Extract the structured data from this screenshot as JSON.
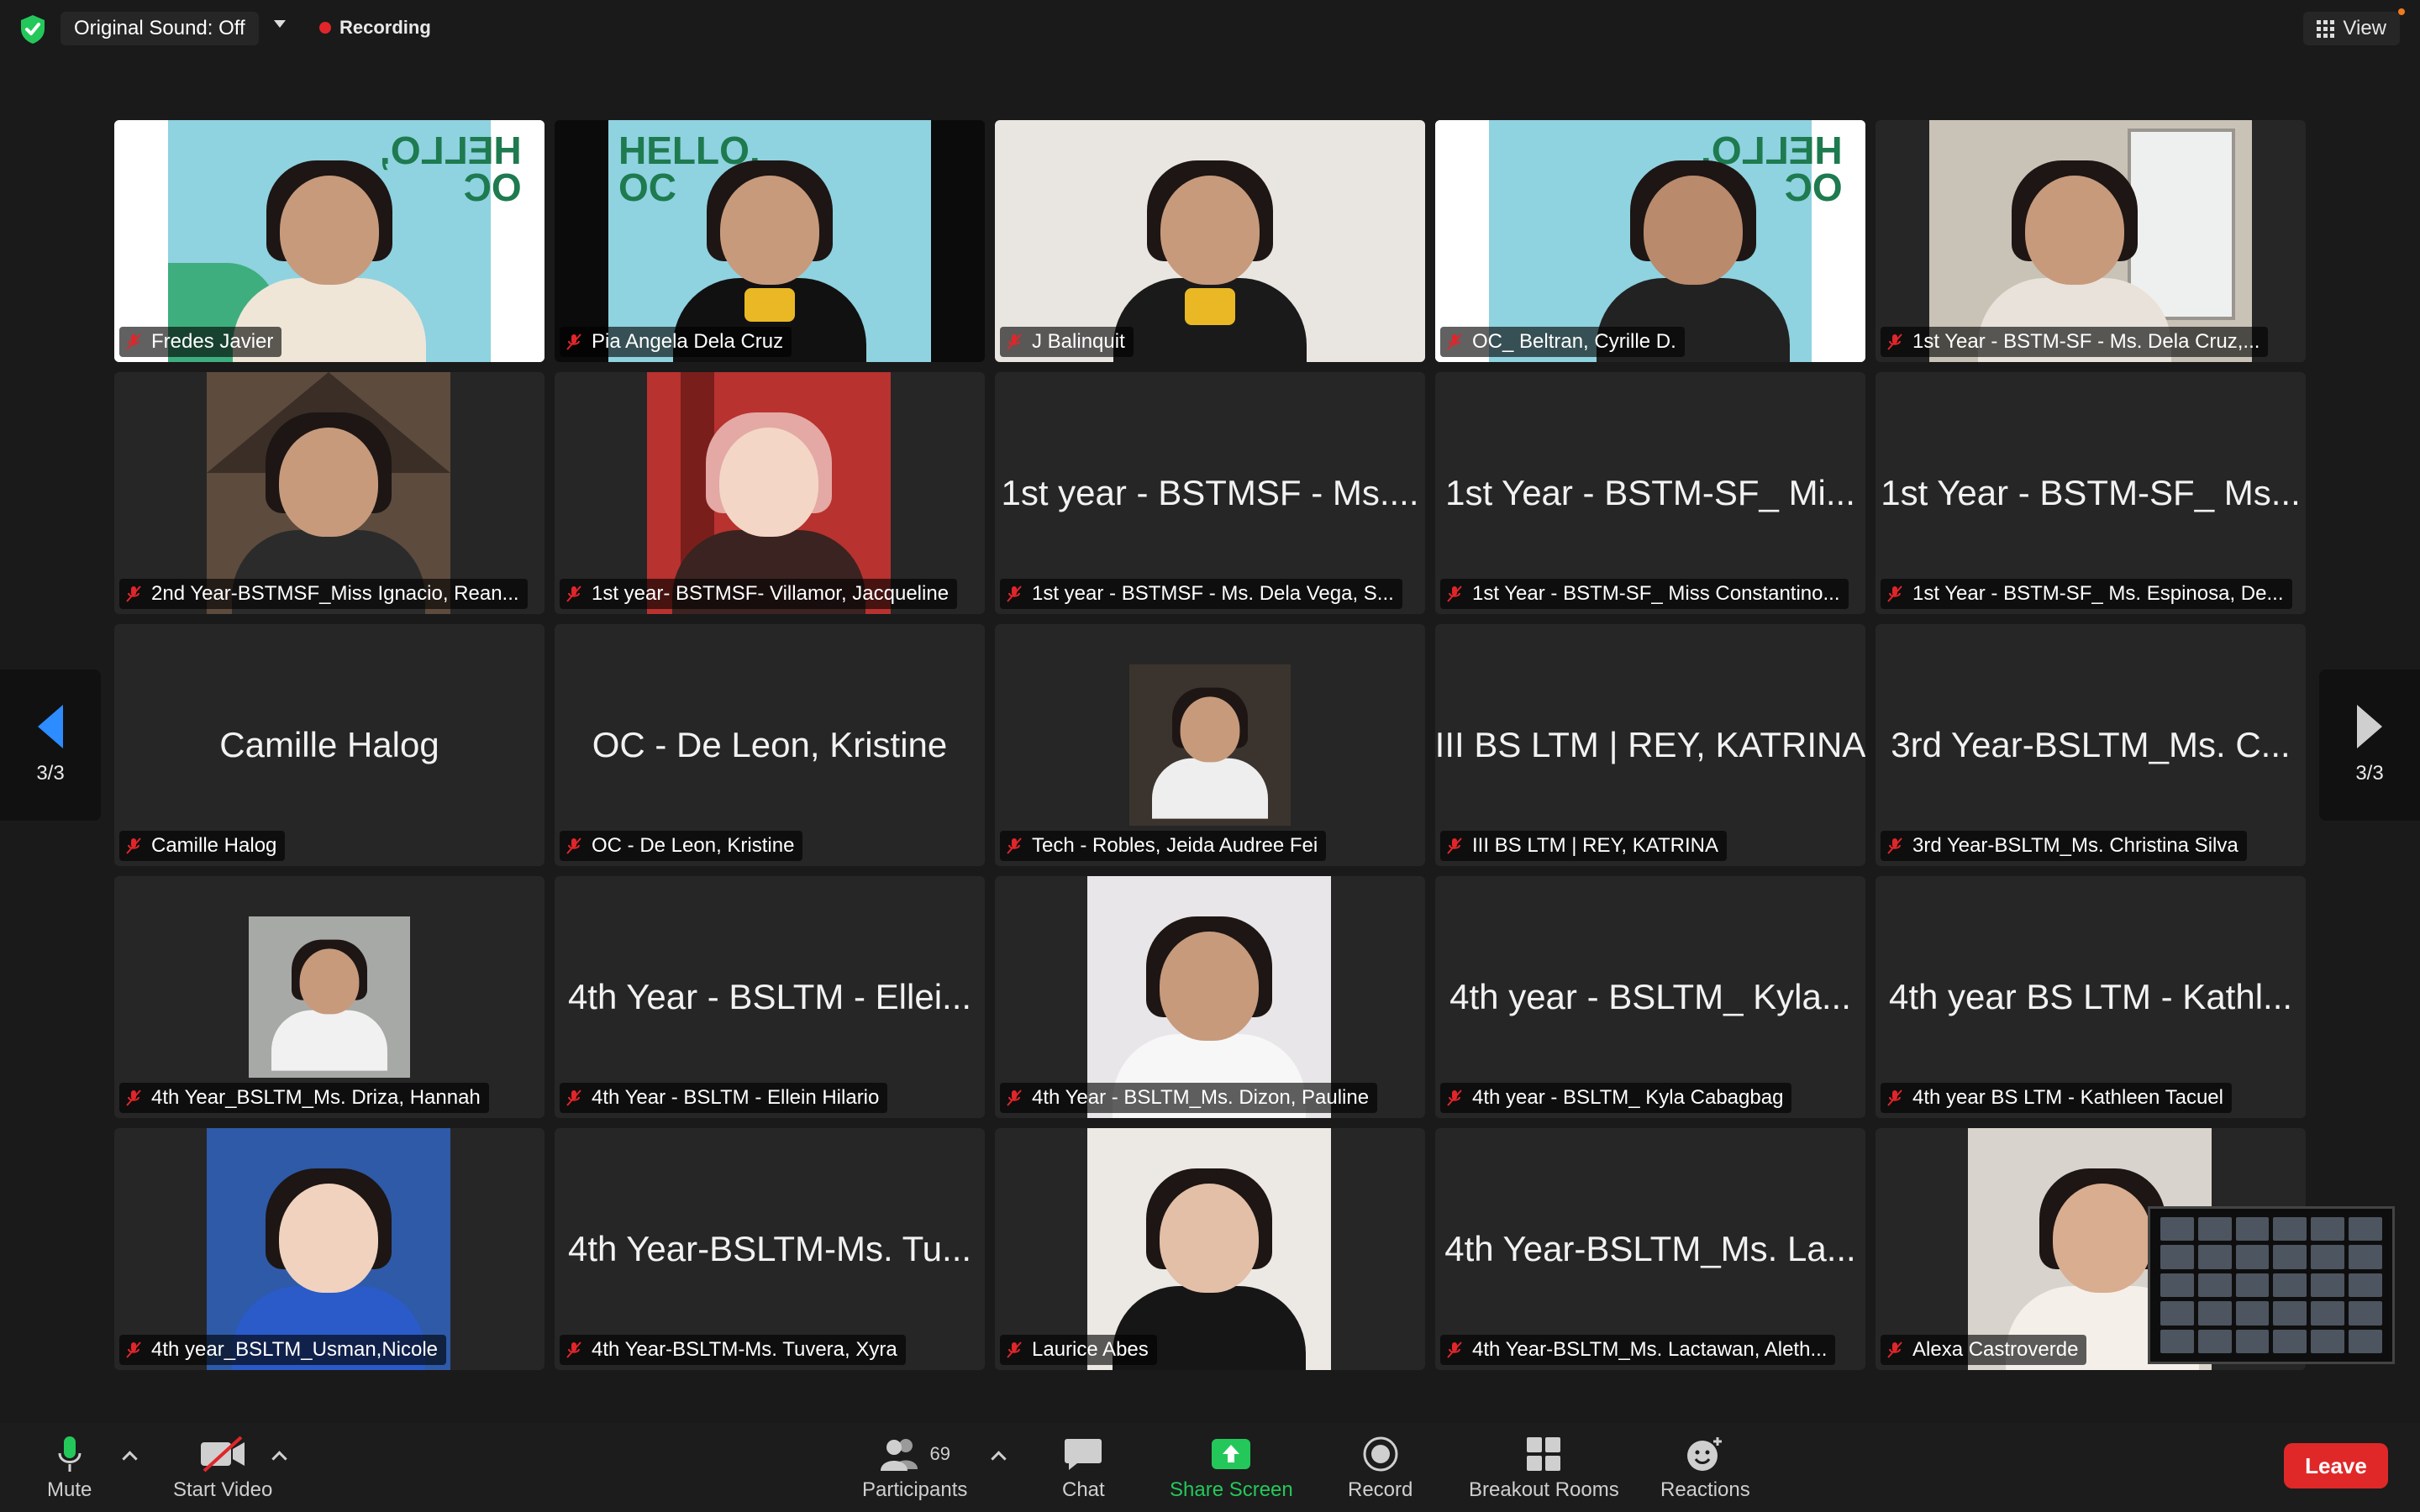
{
  "topbar": {
    "original_sound": "Original Sound: Off",
    "recording": "Recording",
    "view": "View"
  },
  "pager": {
    "left": "3/3",
    "right": "3/3"
  },
  "tiles": [
    {
      "label": "Fredes Javier",
      "center": "",
      "active": true
    },
    {
      "label": "Pia Angela Dela Cruz",
      "center": ""
    },
    {
      "label": "J Balinquit",
      "center": ""
    },
    {
      "label": "OC_ Beltran, Cyrille D.",
      "center": "",
      "active": true
    },
    {
      "label": "1st Year - BSTM-SF - Ms. Dela Cruz,...",
      "center": ""
    },
    {
      "label": "2nd Year-BSTMSF_Miss Ignacio, Rean...",
      "center": ""
    },
    {
      "label": "1st year- BSTMSF- Villamor, Jacqueline",
      "center": ""
    },
    {
      "label": "1st year - BSTMSF - Ms. Dela Vega, S...",
      "center": "1st year - BSTMSF - Ms...."
    },
    {
      "label": "1st Year - BSTM-SF_ Miss Constantino...",
      "center": "1st Year - BSTM-SF_ Mi..."
    },
    {
      "label": "1st Year - BSTM-SF_ Ms. Espinosa, De...",
      "center": "1st Year - BSTM-SF_ Ms..."
    },
    {
      "label": "Camille Halog",
      "center": "Camille Halog"
    },
    {
      "label": "OC - De Leon, Kristine",
      "center": "OC - De Leon, Kristine"
    },
    {
      "label": "Tech - Robles, Jeida Audree Fei",
      "center": ""
    },
    {
      "label": "III BS LTM | REY, KATRINA",
      "center": "III BS LTM | REY, KATRINA"
    },
    {
      "label": "3rd Year-BSLTM_Ms. Christina Silva",
      "center": "3rd Year-BSLTM_Ms. C..."
    },
    {
      "label": "4th Year_BSLTM_Ms. Driza, Hannah",
      "center": ""
    },
    {
      "label": "4th Year - BSLTM - Ellein Hilario",
      "center": "4th Year - BSLTM - Ellei..."
    },
    {
      "label": "4th Year - BSLTM_Ms. Dizon, Pauline",
      "center": ""
    },
    {
      "label": "4th year - BSLTM_ Kyla Cabagbag",
      "center": "4th year - BSLTM_ Kyla..."
    },
    {
      "label": "4th year BS LTM - Kathleen Tacuel",
      "center": "4th year BS LTM - Kathl..."
    },
    {
      "label": "4th year_BSLTM_Usman,Nicole",
      "center": ""
    },
    {
      "label": "4th Year-BSLTM-Ms. Tuvera, Xyra",
      "center": "4th Year-BSLTM-Ms. Tu..."
    },
    {
      "label": "Laurice Abes",
      "center": ""
    },
    {
      "label": "4th Year-BSLTM_Ms. Lactawan, Aleth...",
      "center": "4th Year-BSLTM_Ms. La..."
    },
    {
      "label": "Alexa Castroverde",
      "center": ""
    }
  ],
  "backgrounds": {
    "hello_text": "HELLO,",
    "oc_text": "OC"
  },
  "toolbar": {
    "mute": "Mute",
    "start_video": "Start Video",
    "participants": "Participants",
    "participants_count": "69",
    "chat": "Chat",
    "share_screen": "Share Screen",
    "record": "Record",
    "breakout_rooms": "Breakout Rooms",
    "reactions": "Reactions",
    "leave": "Leave"
  },
  "colors": {
    "accent_green": "#24c85a",
    "leave_red": "#e02828",
    "pager_blue": "#2d8cff"
  }
}
